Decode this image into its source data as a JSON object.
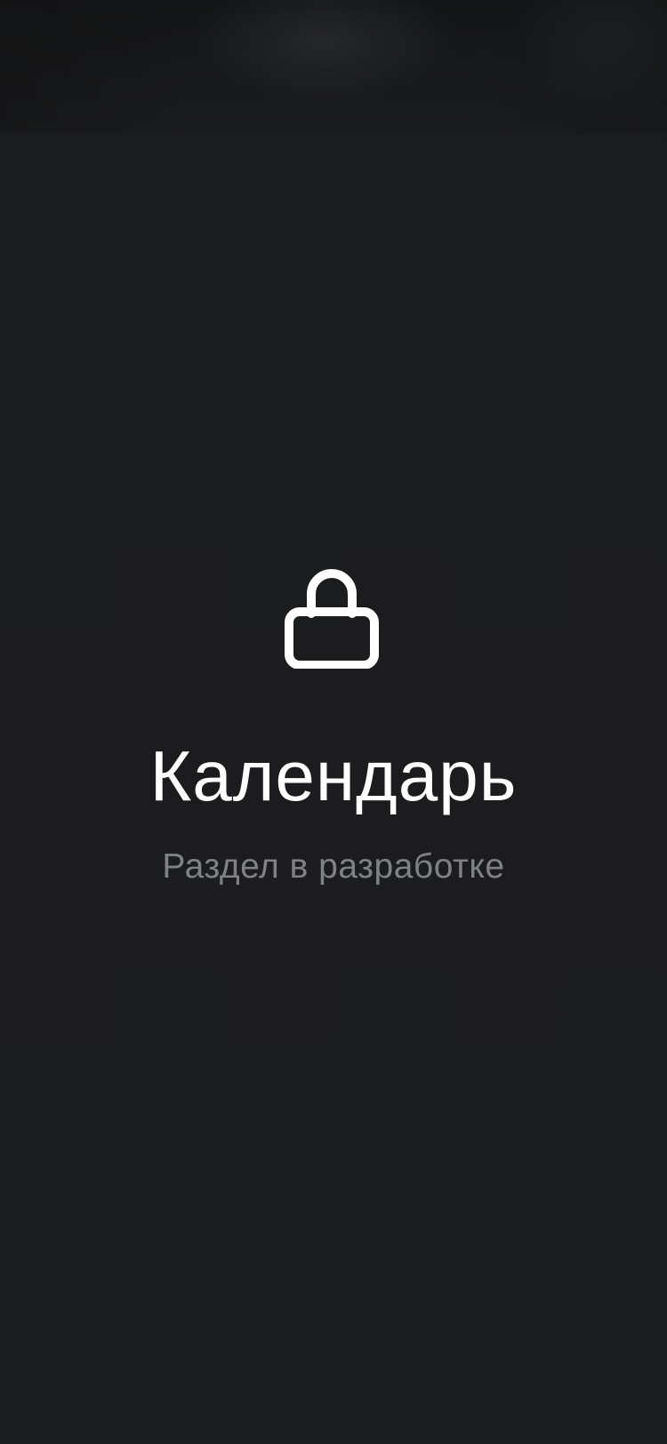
{
  "screen": {
    "title": "Календарь",
    "subtitle": "Раздел в разработке",
    "icon": "lock-icon"
  },
  "colors": {
    "background": "#1c1d1f",
    "title": "#ffffff",
    "subtitle": "#808183",
    "icon": "#ffffff"
  }
}
